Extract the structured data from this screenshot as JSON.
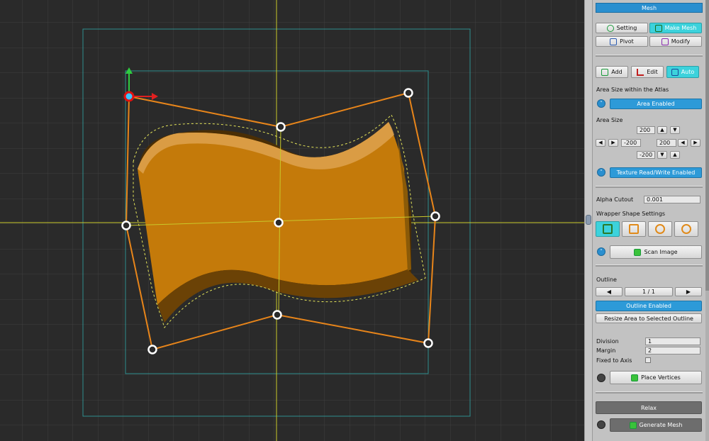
{
  "panel": {
    "title": "Mesh",
    "tabs": {
      "setting": "Setting",
      "make_mesh": "Make Mesh",
      "pivot": "Pivot",
      "modify": "Modify"
    },
    "modes": {
      "add": "Add",
      "edit": "Edit",
      "auto": "Auto"
    },
    "area_size_within_atlas_label": "Area Size within the Atlas",
    "area_enabled": "Area Enabled",
    "area_size_label": "Area Size",
    "area": {
      "top": "200",
      "left": "-200",
      "right": "200",
      "bottom": "-200"
    },
    "texture_rw": "Texture Read/Write Enabled",
    "alpha_cutout_label": "Alpha Cutout",
    "alpha_cutout_value": "0.001",
    "wrapper_shape_label": "Wrapper Shape Settings",
    "scan_image": "Scan Image",
    "outline_label": "Outline",
    "outline_page": "1 / 1",
    "outline_enabled": "Outline Enabled",
    "resize_area": "Resize Area to Selected Outline",
    "division_label": "Division",
    "division_value": "1",
    "margin_label": "Margin",
    "margin_value": "2",
    "fixed_axis_label": "Fixed to Axis",
    "place_vertices": "Place Vertices",
    "relax": "Relax",
    "generate_mesh": "Generate Mesh",
    "colors": {
      "accent_blue": "#2a8fcf",
      "selected_cyan": "#3cd2dc",
      "outline_orange": "#e8851a",
      "mesh_fill": "#c47a0a"
    }
  }
}
